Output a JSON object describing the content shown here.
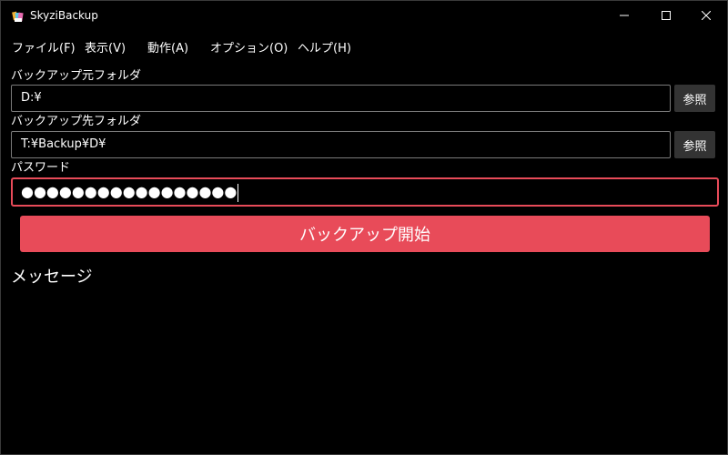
{
  "window": {
    "title": "SkyziBackup"
  },
  "menu": [
    {
      "label": "ファイル(F)"
    },
    {
      "label": "表示(V)"
    },
    {
      "label": "動作(A)"
    },
    {
      "label": "オプション(O)"
    },
    {
      "label": "ヘルプ(H)"
    }
  ],
  "source": {
    "label": "バックアップ元フォルダ",
    "value": "D:¥",
    "browse_label": "参照"
  },
  "destination": {
    "label": "バックアップ先フォルダ",
    "value": "T:¥Backup¥D¥",
    "browse_label": "参照"
  },
  "password": {
    "label": "パスワード",
    "masked_value": "●●●●●●●●●●●●●●●●●"
  },
  "start_button": {
    "label": "バックアップ開始"
  },
  "messages": {
    "title": "メッセージ"
  },
  "colors": {
    "accent": "#e84b59",
    "background": "#000000",
    "button": "#333333",
    "field_border": "#7a7a7a"
  },
  "icons": {
    "app": "app-icon",
    "minimize": "minimize-icon",
    "maximize": "maximize-icon",
    "close": "close-icon"
  }
}
